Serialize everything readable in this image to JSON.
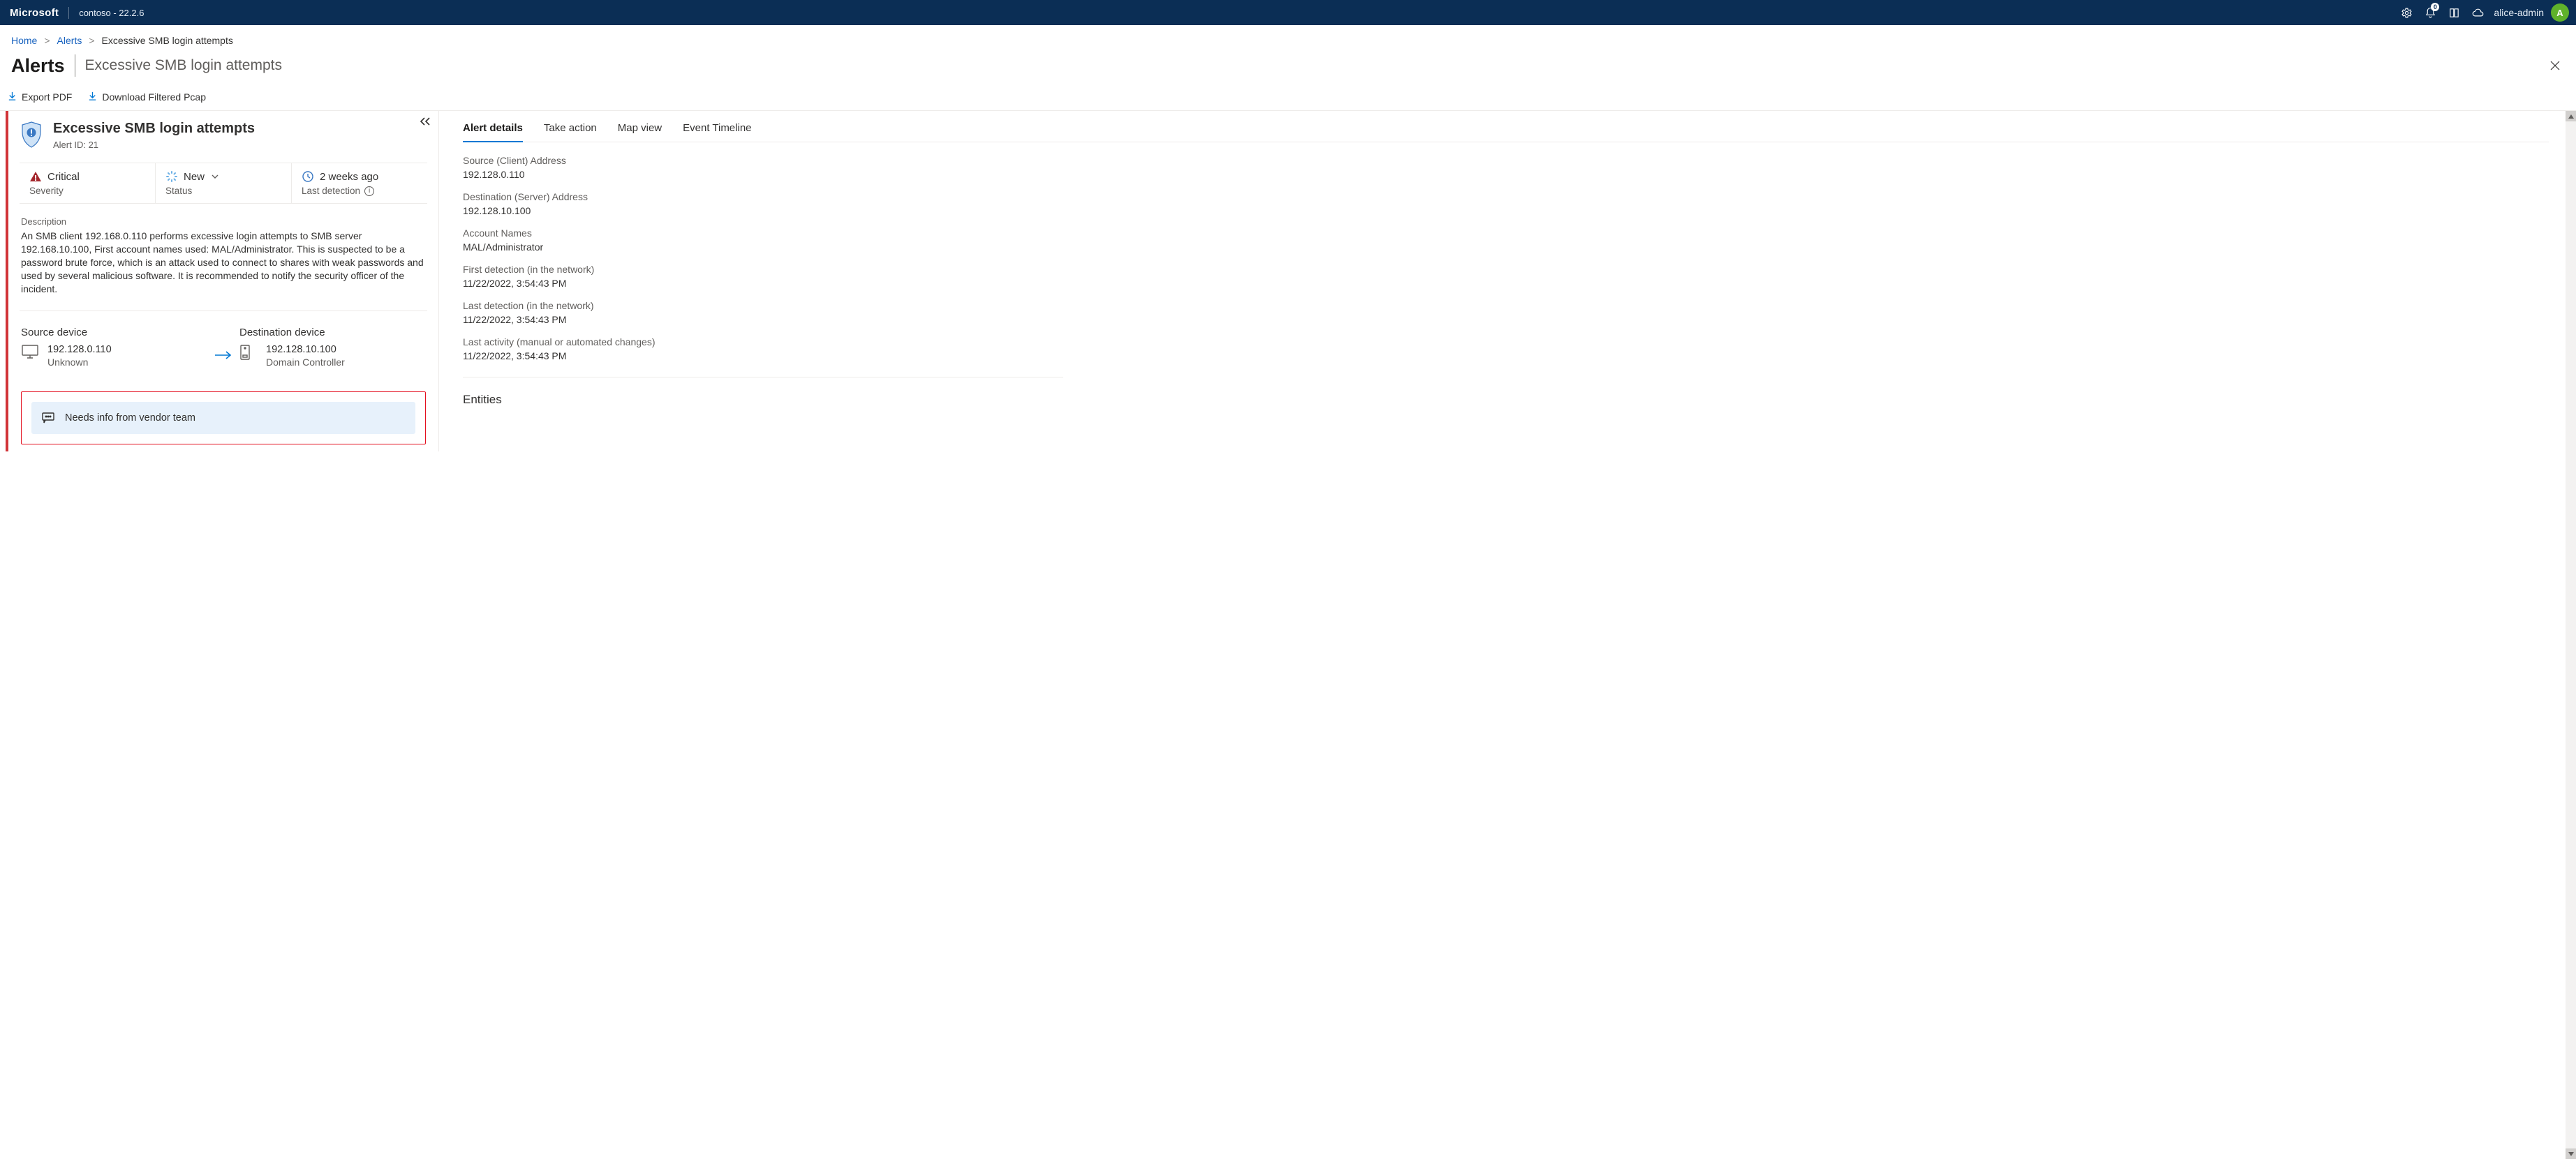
{
  "header": {
    "brand": "Microsoft",
    "tenant": "contoso - 22.2.6",
    "notification_count": "0",
    "user_name": "alice-admin",
    "avatar_initial": "A"
  },
  "breadcrumb": {
    "home": "Home",
    "alerts": "Alerts",
    "current": "Excessive SMB login attempts"
  },
  "page_head": {
    "section": "Alerts",
    "title": "Excessive SMB login attempts"
  },
  "commands": {
    "export_pdf": "Export PDF",
    "download_pcap": "Download Filtered Pcap"
  },
  "alert": {
    "title": "Excessive SMB login attempts",
    "id_label": "Alert ID: 21",
    "severity_value": "Critical",
    "severity_label": "Severity",
    "status_value": "New",
    "status_label": "Status",
    "last_detection_value": "2 weeks ago",
    "last_detection_label": "Last detection",
    "description_label": "Description",
    "description_text": "An SMB client 192.168.0.110 performs excessive login attempts to SMB server 192.168.10.100, First account names used: MAL/Administrator. This is suspected to be a password brute force, which is an attack used to connect to shares with weak passwords and used by several malicious software. It is recommended to notify the security officer of the incident.",
    "source_device_label": "Source device",
    "source_ip": "192.128.0.110",
    "source_type": "Unknown",
    "destination_device_label": "Destination device",
    "destination_ip": "192.128.10.100",
    "destination_type": "Domain Controller",
    "comment": "Needs info from vendor team"
  },
  "tabs": {
    "details": "Alert details",
    "take_action": "Take action",
    "map_view": "Map view",
    "event_timeline": "Event Timeline"
  },
  "details": {
    "src_addr_k": "Source (Client) Address",
    "src_addr_v": "192.128.0.110",
    "dst_addr_k": "Destination (Server) Address",
    "dst_addr_v": "192.128.10.100",
    "accounts_k": "Account Names",
    "accounts_v": "MAL/Administrator",
    "first_det_k": "First detection (in the network)",
    "first_det_v": "11/22/2022, 3:54:43 PM",
    "last_det_k": "Last detection (in the network)",
    "last_det_v": "11/22/2022, 3:54:43 PM",
    "last_act_k": "Last activity (manual or automated changes)",
    "last_act_v": "11/22/2022, 3:54:43 PM",
    "entities_heading": "Entities"
  }
}
